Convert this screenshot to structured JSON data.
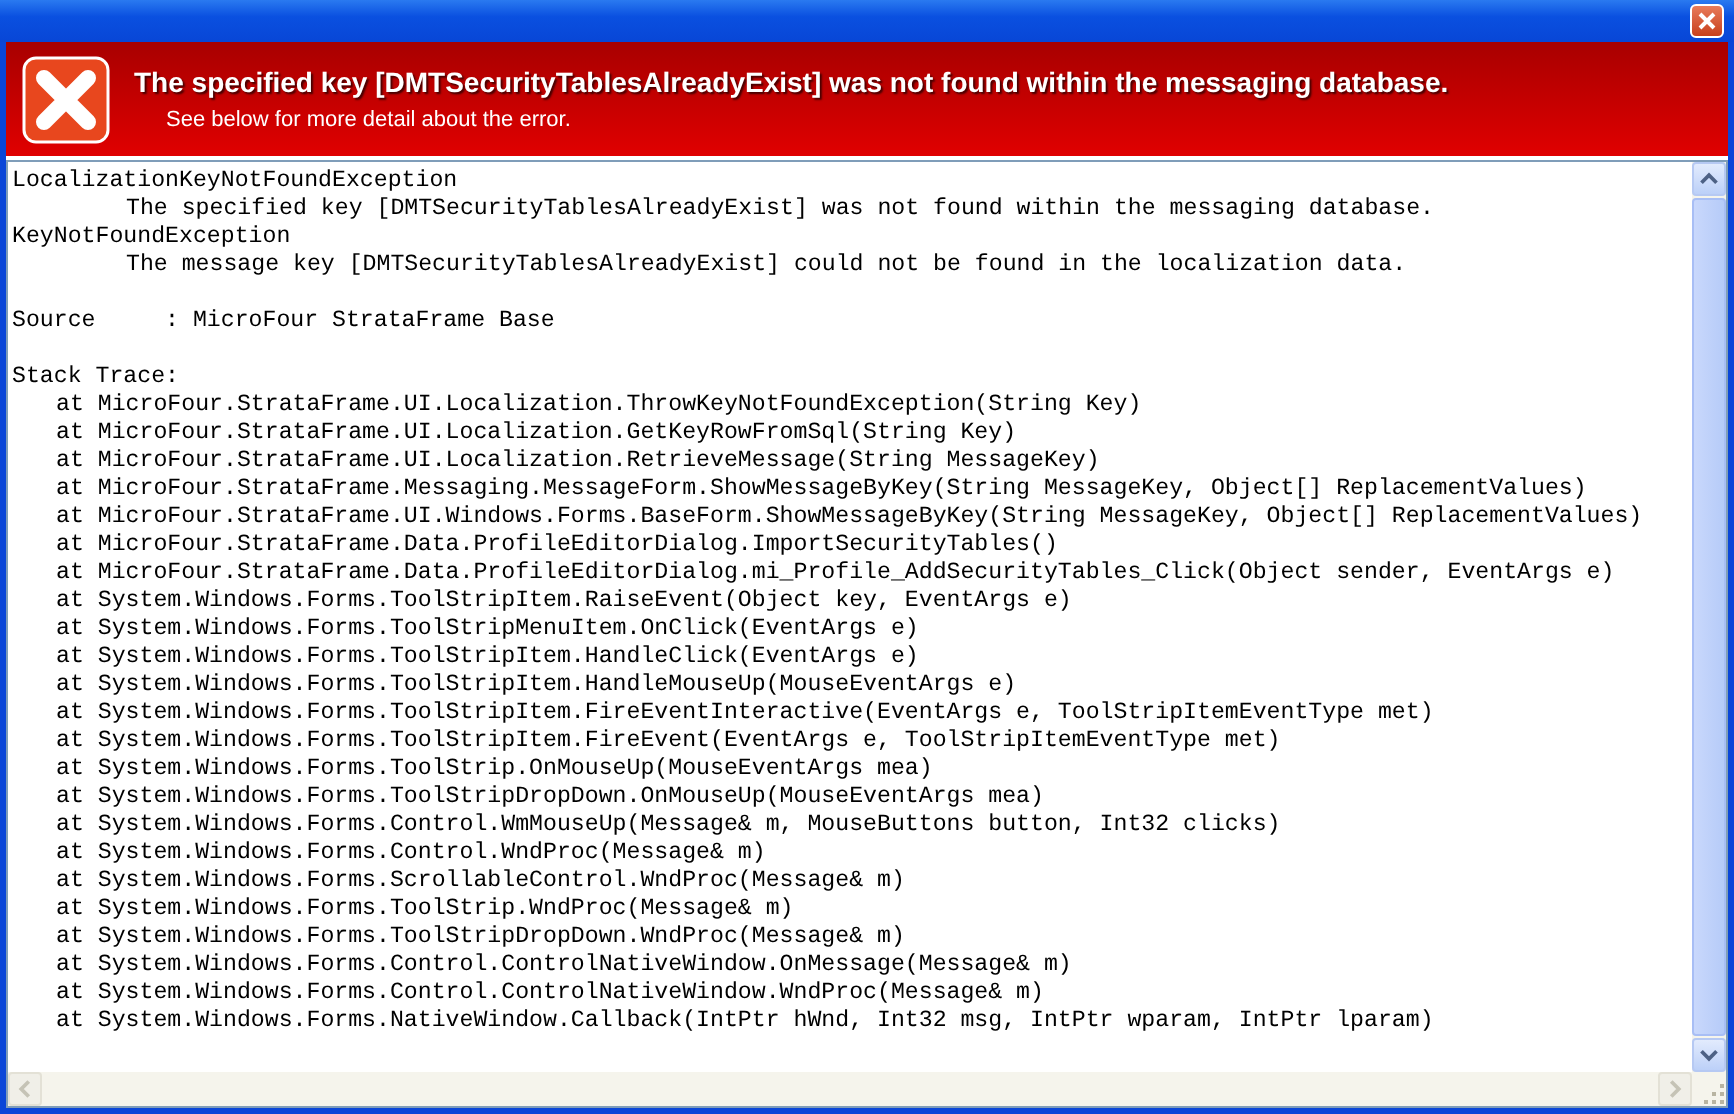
{
  "header": {
    "title": "The specified key [DMTSecurityTablesAlreadyExist] was not found within the messaging database.",
    "subtitle": "See below for more detail about the error."
  },
  "exceptions": [
    {
      "name": "LocalizationKeyNotFoundException",
      "message": "The specified key [DMTSecurityTablesAlreadyExist] was not found within the messaging database."
    },
    {
      "name": "KeyNotFoundException",
      "message": "The message key [DMTSecurityTablesAlreadyExist] could not be found in the localization data."
    }
  ],
  "source": "Source     : MicroFour StrataFrame Base",
  "stack_trace": {
    "label": "Stack Trace:",
    "frames": [
      "at MicroFour.StrataFrame.UI.Localization.ThrowKeyNotFoundException(String Key)",
      "at MicroFour.StrataFrame.UI.Localization.GetKeyRowFromSql(String Key)",
      "at MicroFour.StrataFrame.UI.Localization.RetrieveMessage(String MessageKey)",
      "at MicroFour.StrataFrame.Messaging.MessageForm.ShowMessageByKey(String MessageKey, Object[] ReplacementValues)",
      "at MicroFour.StrataFrame.UI.Windows.Forms.BaseForm.ShowMessageByKey(String MessageKey, Object[] ReplacementValues)",
      "at MicroFour.StrataFrame.Data.ProfileEditorDialog.ImportSecurityTables()",
      "at MicroFour.StrataFrame.Data.ProfileEditorDialog.mi_Profile_AddSecurityTables_Click(Object sender, EventArgs e)",
      "at System.Windows.Forms.ToolStripItem.RaiseEvent(Object key, EventArgs e)",
      "at System.Windows.Forms.ToolStripMenuItem.OnClick(EventArgs e)",
      "at System.Windows.Forms.ToolStripItem.HandleClick(EventArgs e)",
      "at System.Windows.Forms.ToolStripItem.HandleMouseUp(MouseEventArgs e)",
      "at System.Windows.Forms.ToolStripItem.FireEventInteractive(EventArgs e, ToolStripItemEventType met)",
      "at System.Windows.Forms.ToolStripItem.FireEvent(EventArgs e, ToolStripItemEventType met)",
      "at System.Windows.Forms.ToolStrip.OnMouseUp(MouseEventArgs mea)",
      "at System.Windows.Forms.ToolStripDropDown.OnMouseUp(MouseEventArgs mea)",
      "at System.Windows.Forms.Control.WmMouseUp(Message& m, MouseButtons button, Int32 clicks)",
      "at System.Windows.Forms.Control.WndProc(Message& m)",
      "at System.Windows.Forms.ScrollableControl.WndProc(Message& m)",
      "at System.Windows.Forms.ToolStrip.WndProc(Message& m)",
      "at System.Windows.Forms.ToolStripDropDown.WndProc(Message& m)",
      "at System.Windows.Forms.Control.ControlNativeWindow.OnMessage(Message& m)",
      "at System.Windows.Forms.Control.ControlNativeWindow.WndProc(Message& m)",
      "at System.Windows.Forms.NativeWindow.Callback(IntPtr hWnd, Int32 msg, IntPtr wparam, IntPtr lparam)"
    ]
  }
}
